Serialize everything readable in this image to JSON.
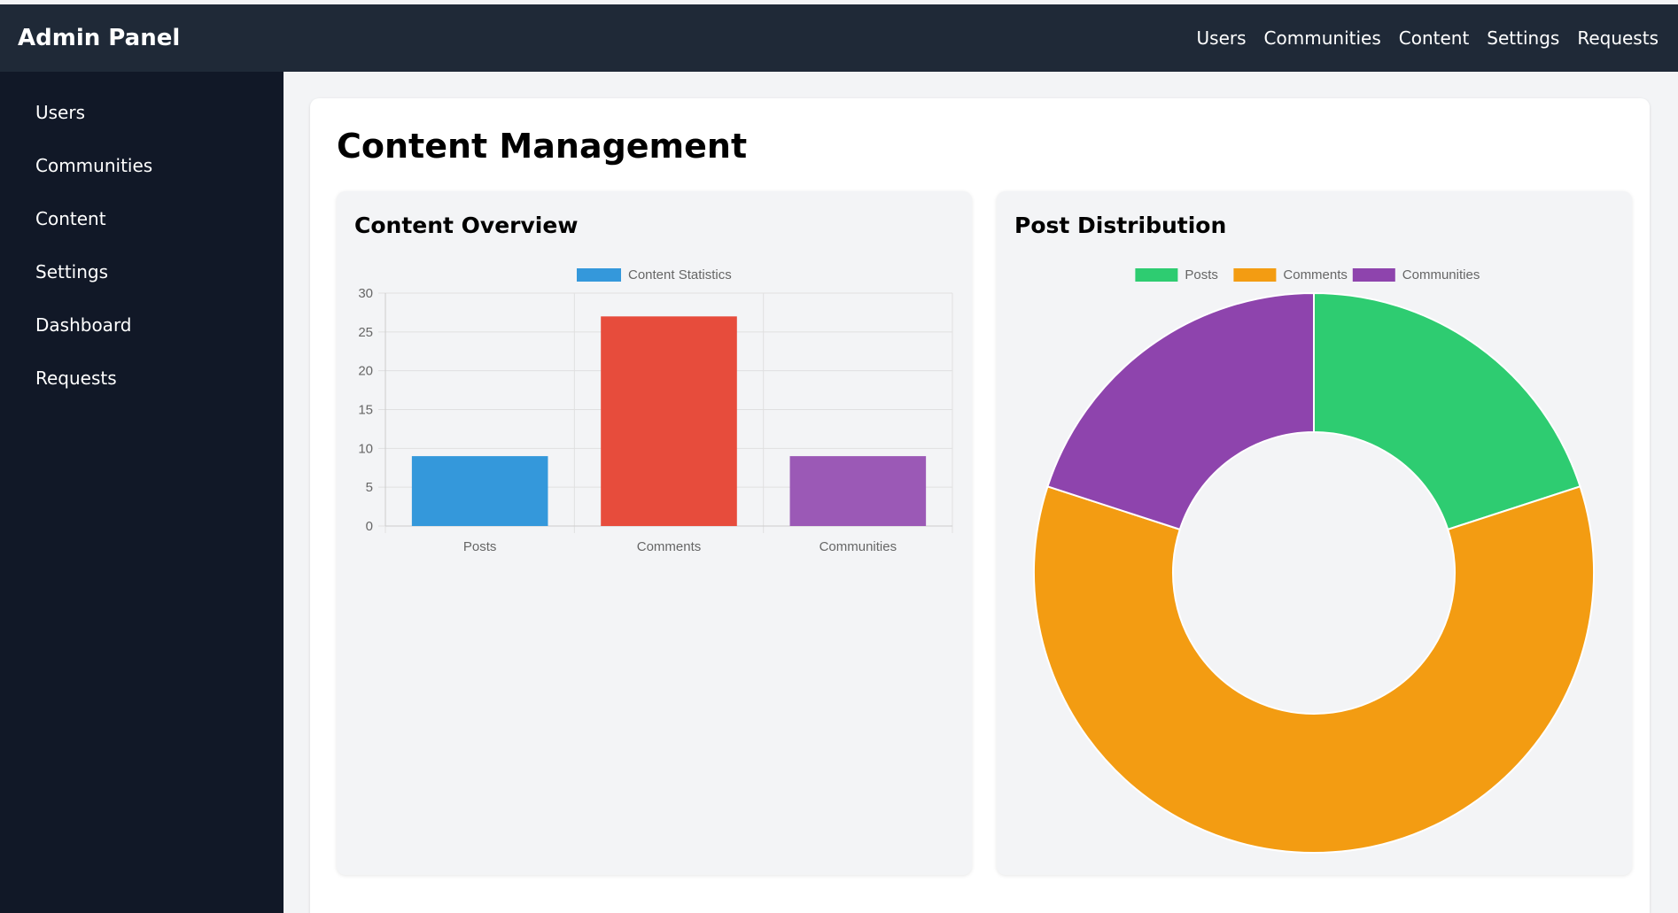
{
  "app": {
    "title": "Admin Panel"
  },
  "topnav": [
    {
      "label": "Users"
    },
    {
      "label": "Communities"
    },
    {
      "label": "Content"
    },
    {
      "label": "Settings"
    },
    {
      "label": "Requests"
    }
  ],
  "sidebar": [
    {
      "label": "Users"
    },
    {
      "label": "Communities"
    },
    {
      "label": "Content"
    },
    {
      "label": "Settings"
    },
    {
      "label": "Dashboard"
    },
    {
      "label": "Requests"
    }
  ],
  "page": {
    "title": "Content Management"
  },
  "panels": {
    "overview_title": "Content Overview",
    "distribution_title": "Post Distribution"
  },
  "colors": {
    "navbar": "#1f2937",
    "sidebar": "#111827",
    "blue": "#3498db",
    "red": "#e74c3c",
    "purple": "#9b59b6",
    "green": "#2ecc71",
    "orange": "#f39c12",
    "dark_purple": "#8e44ad"
  },
  "chart_data": [
    {
      "type": "bar",
      "legend": [
        "Content Statistics"
      ],
      "categories": [
        "Posts",
        "Comments",
        "Communities"
      ],
      "values": [
        9,
        27,
        9
      ],
      "bar_colors": [
        "#3498db",
        "#e74c3c",
        "#9b59b6"
      ],
      "ylim": [
        0,
        30
      ],
      "yticks": [
        "0",
        "5",
        "10",
        "15",
        "20",
        "25",
        "30"
      ],
      "grid": true,
      "legend_position": "top"
    },
    {
      "type": "pie",
      "donut": true,
      "labels": [
        "Posts",
        "Comments",
        "Communities"
      ],
      "values": [
        9,
        27,
        9
      ],
      "colors": [
        "#2ecc71",
        "#f39c12",
        "#8e44ad"
      ],
      "legend_position": "top"
    }
  ]
}
